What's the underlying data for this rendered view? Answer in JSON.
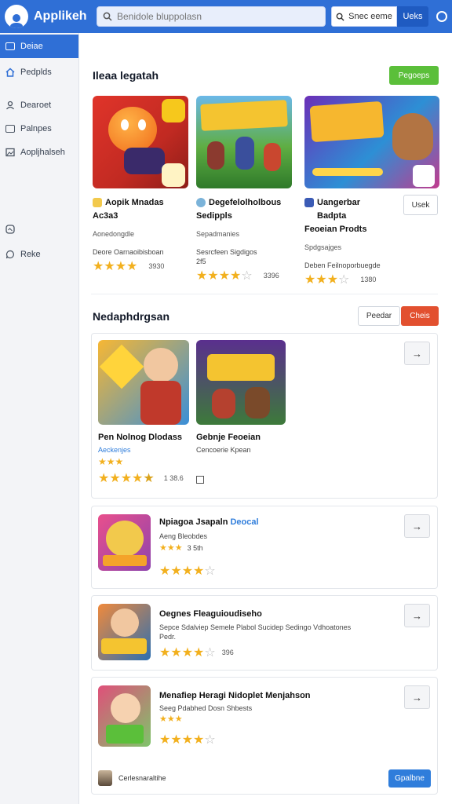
{
  "header": {
    "app_title": "Applikeh",
    "search_placeholder": "Benidole bluppolasn",
    "search_button": "Snec eeme",
    "action_button": "Ueks"
  },
  "sidebar": {
    "items": [
      {
        "label": "Deiae",
        "icon": "list-icon",
        "active": true
      },
      {
        "label": "Pedplds",
        "icon": "home-icon",
        "active": false
      },
      {
        "label": "Dearoet",
        "icon": "user-icon",
        "active": false
      },
      {
        "label": "Palnpes",
        "icon": "grid-icon",
        "active": false
      },
      {
        "label": "Aopljhalseh",
        "icon": "image-icon",
        "active": false
      },
      {
        "label": "",
        "icon": "settings-icon",
        "active": false
      },
      {
        "label": "Reke",
        "icon": "chat-icon",
        "active": false
      }
    ]
  },
  "featured": {
    "title": "Ileaa legatah",
    "action": "Pegoeps",
    "view_button": "Usek",
    "cards": [
      {
        "title": "Aopik Mnadas",
        "code": "Ac3a3",
        "category": "Aonedongdle",
        "desc": "Deore Oarnaoibisboan",
        "desc2": "",
        "rating": 4.0,
        "count": "3930",
        "colors": [
          "#f2c94c",
          "#d63a2f"
        ]
      },
      {
        "title": "Degefelolholbous",
        "code": "Sedippls",
        "category": "Sepadmanies",
        "desc": "Sesrcfeen Sigdigos",
        "desc2": "2f5",
        "rating": 3.5,
        "count": "3396",
        "colors": [
          "#7bbf4a",
          "#2e7d32"
        ]
      },
      {
        "title": "Uangerbar Badpta",
        "code": "Feoeian Prodts",
        "category": "Spdgsajges",
        "desc": "Deben Feilnoporbuegde",
        "desc2": "",
        "rating": 3.0,
        "count": "1380",
        "colors": [
          "#7b3fb8",
          "#2d8fd5"
        ]
      }
    ]
  },
  "recommended": {
    "title": "Nedaphdrgsan",
    "sort_button": "Peedar",
    "hot_button": "Cheis",
    "arrow": "→",
    "group_cards": [
      {
        "title": "Pen Nolnog Dlodass",
        "sub": "Aeckenjes",
        "rating": 4.0,
        "count": "1 38.6",
        "colors": [
          "#f5b031",
          "#3a8fd8"
        ]
      },
      {
        "title": "Gebnje Feoeian",
        "sub": "Cencoerie Kpean",
        "rating": 0,
        "count": "",
        "colors": [
          "#6b3fa0",
          "#3d7a3a"
        ]
      }
    ],
    "list": [
      {
        "title": "Npiagoa Jsapaln",
        "tag": "Deocal",
        "sub": "Aeng Bleobdes",
        "sub2": "3 5th",
        "rating": 3.5,
        "count": "",
        "colors": [
          "#e94f8c",
          "#f2c94c"
        ]
      },
      {
        "title": "Oegnes Fleaguioudiseho",
        "sub": "Sepce Sdalviep Semele Plabol Sucidep Sedingo Vdhoatones",
        "sub2": "Pedr.",
        "rating": 3.5,
        "count": "396",
        "colors": [
          "#f08a3c",
          "#2d6fb0"
        ]
      },
      {
        "title": "Menafiep Heragi Nidoplet Menjahson",
        "sub": "Seeg Pdabhed Dosn Shbests",
        "sub2": "",
        "rating": 4.0,
        "count": "",
        "colors": [
          "#7fc46b",
          "#e04f7a"
        ]
      }
    ],
    "footer_user": "Cerlesnaraltihe",
    "footer_button": "Gpalbne"
  },
  "colors": {
    "primary": "#2f6fd6",
    "accent_green": "#5bbf3a",
    "accent_red": "#e2502f",
    "star": "#f2b01e"
  }
}
